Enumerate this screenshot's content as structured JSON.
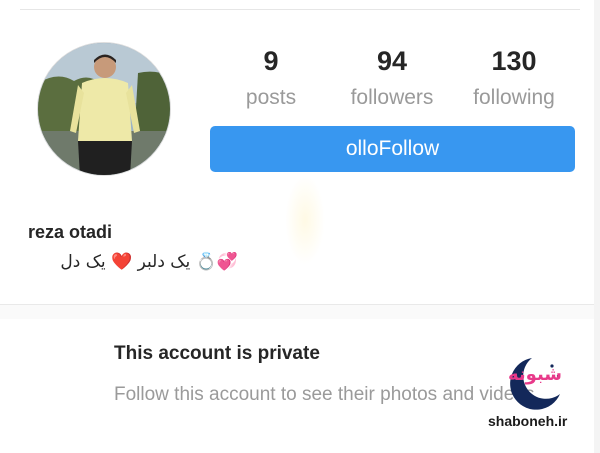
{
  "profile": {
    "username": "reza otadi",
    "bio": "💞💍 یک دلبر ❤️ یک دل",
    "avatar_icon": "profile-photo"
  },
  "stats": {
    "posts_count": "9",
    "posts_label": "posts",
    "followers_count": "94",
    "followers_label": "followers",
    "following_count": "130",
    "following_label": "following"
  },
  "actions": {
    "follow_label": "olloFollow"
  },
  "private_notice": {
    "title": "This account is private",
    "message": "Follow this account to see their photos and videos."
  },
  "watermark": {
    "script": "شبونه",
    "url": "shaboneh.ir"
  },
  "colors": {
    "accent": "#3897f0",
    "muted_text": "#9a9a9a",
    "watermark_pink": "#e83a8a"
  }
}
